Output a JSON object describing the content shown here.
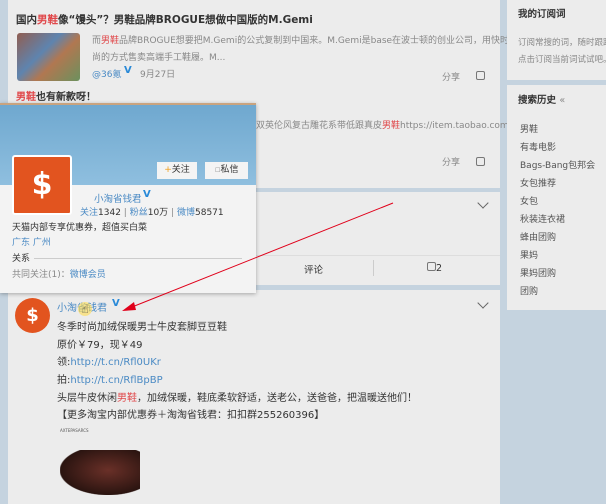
{
  "feed": {
    "post1": {
      "title_pre": "国内",
      "title_kw": "男鞋",
      "title_post": "像“馒头”？男鞋品牌BROGUE想做中国版的M.Gemi",
      "summary_pre": "而",
      "summary_kw": "男鞋",
      "summary_post": "品牌BROGUE想要把M.Gemi的公式复制到中国来。M.Gemi是base在波士顿的创业公司，用快时",
      "summary_line2": "尚的方式售卖高端手工鞋履。M...",
      "author": "@36氪",
      "date": "9月27日",
      "share": "分享"
    },
    "post2": {
      "title_kw": "男鞋",
      "title_post": "也有新款呀！",
      "text_pre": "双英伦风复古雕花系带低跟真皮",
      "text_kw": "男鞋",
      "text_link": "https://item.taobao.com/i",
      "share": "分享"
    },
    "post3": {
      "comment": "评论",
      "likes": "2"
    },
    "post4": {
      "author": "小淘省钱君",
      "line1": "冬季时尚加绒保暖男士牛皮套脚豆豆鞋",
      "line2": "原价￥79，现￥49",
      "line3_label": "领:",
      "line3_link": "http://t.cn/Rfl0UKr",
      "line4_label": "拍:",
      "line4_link": "http://t.cn/RflBpBP",
      "line5_pre": "头层牛皮休闲",
      "line5_kw": "男鞋",
      "line5_post": "，加绒保暖，鞋底柔软舒适，送老公，送爸爸，把温暖送他们！",
      "line6": "【更多淘宝内部优惠券＋淘淘省钱君：扣扣群255260396】",
      "image_brand": "AXTEPASARCS"
    }
  },
  "popup": {
    "follow": "关注",
    "message": "私信",
    "name": "小淘省钱君",
    "following_label": "关注",
    "following": "1342",
    "fans_label": "粉丝",
    "fans": "10万",
    "weibo_label": "微博",
    "weibo": "58571",
    "bio": "天猫内部专享优惠券，超值买白菜",
    "location": "广东 广州",
    "relation_title": "关系",
    "mutual_label": "共同关注(1)：",
    "mutual_link": "微博会员"
  },
  "sidebar": {
    "subscribe_title": "我的订阅词",
    "subscribe_line1": "订阅常搜的词，随时跟踪",
    "subscribe_line2": "点击订阅当前词试试吧。",
    "history_title": "搜索历史",
    "history_toggle": "«",
    "history": [
      "男鞋",
      "有毒电影",
      "Bags-Bang包邦会",
      "女包推荐",
      "女包",
      "秋装连衣裙",
      "蜂由团购",
      "果妈",
      "果妈团购",
      "团购"
    ]
  },
  "colors": {
    "accent": "#e0474a",
    "link": "#4a8ac4",
    "annotation": "#e0001a"
  }
}
